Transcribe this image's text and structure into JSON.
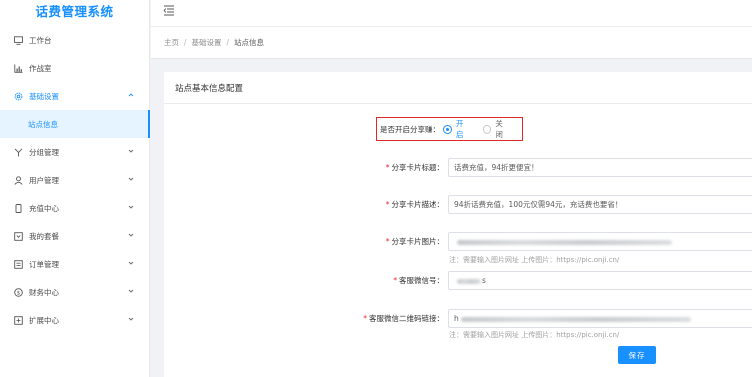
{
  "app": {
    "title": "话费管理系统"
  },
  "sidebar": {
    "items": [
      {
        "label": "工作台",
        "icon": "monitor-icon",
        "expandable": false
      },
      {
        "label": "作战室",
        "icon": "bar-chart-icon",
        "expandable": false
      },
      {
        "label": "基础设置",
        "icon": "gear-icon",
        "expandable": true,
        "open": true
      },
      {
        "label": "站点信息",
        "icon": "",
        "expandable": false,
        "active": true,
        "sub": true
      },
      {
        "label": "分组管理",
        "icon": "branch-icon",
        "expandable": true
      },
      {
        "label": "用户管理",
        "icon": "user-icon",
        "expandable": true
      },
      {
        "label": "充值中心",
        "icon": "phone-icon",
        "expandable": true
      },
      {
        "label": "我的套餐",
        "icon": "package-icon",
        "expandable": true
      },
      {
        "label": "订单管理",
        "icon": "order-icon",
        "expandable": true
      },
      {
        "label": "财务中心",
        "icon": "finance-icon",
        "expandable": true
      },
      {
        "label": "扩展中心",
        "icon": "extension-icon",
        "expandable": true
      }
    ]
  },
  "breadcrumb": {
    "home": "主页",
    "parent": "基础设置",
    "current": "站点信息",
    "separator": "/"
  },
  "card": {
    "title": "站点基本信息配置"
  },
  "form": {
    "share_toggle": {
      "label": "是否开启分享赚：",
      "on_label": "开启",
      "off_label": "关闭",
      "value": "开启"
    },
    "share_title": {
      "label": "分享卡片标题：",
      "value": "话费充值，94折更便宜！"
    },
    "share_desc": {
      "label": "分享卡片描述：",
      "value": "94折话费充值，100元仅需94元，充话费也要省！"
    },
    "share_image": {
      "label": "分享卡片图片：",
      "value": "",
      "hint": "注：需要输入图片网址 上传图片：https://pic.onji.cn/"
    },
    "service_wechat": {
      "label": "客服微信号：",
      "value": "s"
    },
    "service_qr": {
      "label": "客服微信二维码链接：",
      "value": "h",
      "hint": "注：需要输入图片网址 上传图片：https://pic.onji.cn/"
    },
    "save_label": "保存"
  },
  "colors": {
    "accent": "#1890ff",
    "highlight": "#e02828",
    "required": "#f5222d"
  }
}
